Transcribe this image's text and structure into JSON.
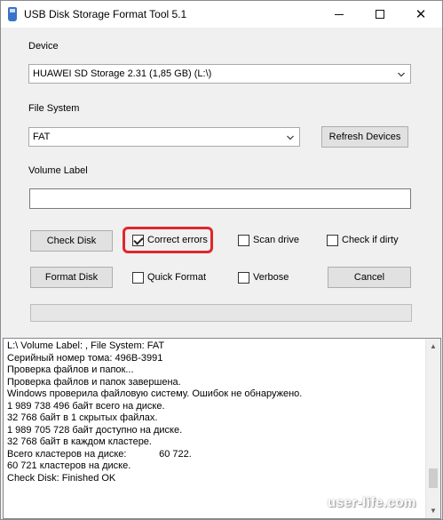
{
  "window": {
    "title": "USB Disk Storage Format Tool 5.1",
    "controls": {
      "minimize": "—",
      "maximize": "☐",
      "close": "✕"
    }
  },
  "device": {
    "label": "Device",
    "selected": "HUAWEI  SD Storage  2.31 (1,85 GB) (L:\\)"
  },
  "file_system": {
    "label": "File System",
    "selected": "FAT",
    "refresh_label": "Refresh Devices"
  },
  "volume_label": {
    "label": "Volume Label",
    "value": ""
  },
  "actions": {
    "check_disk": "Check Disk",
    "format_disk": "Format Disk",
    "cancel": "Cancel"
  },
  "options": {
    "correct_errors": {
      "label": "Correct errors",
      "checked": true
    },
    "scan_drive": {
      "label": "Scan drive",
      "checked": false
    },
    "check_if_dirty": {
      "label": "Check if dirty",
      "checked": false
    },
    "quick_format": {
      "label": "Quick Format",
      "checked": false
    },
    "verbose": {
      "label": "Verbose",
      "checked": false
    }
  },
  "progress": {
    "value": 0
  },
  "log": [
    "L:\\ Volume Label: , File System: FAT",
    "Серийный номер тома: 496B-3991",
    "Проверка файлов и папок...",
    "Проверка файлов и папок завершена.",
    "Windows проверила файловую систему. Ошибок не обнаружено.",
    "1 989 738 496 байт всего на диске.",
    "32 768 байт в 1 скрытых файлах.",
    "1 989 705 728 байт доступно на диске.",
    "32 768 байт в каждом кластере.",
    "Всего кластеров на диске:            60 722.",
    "60 721 кластеров на диске.",
    "Check Disk: Finished OK"
  ],
  "watermark": "user-life.com",
  "colors": {
    "highlight": "#e0262c",
    "progress_fill": "#06b025",
    "app_icon": "#3a73c9"
  }
}
